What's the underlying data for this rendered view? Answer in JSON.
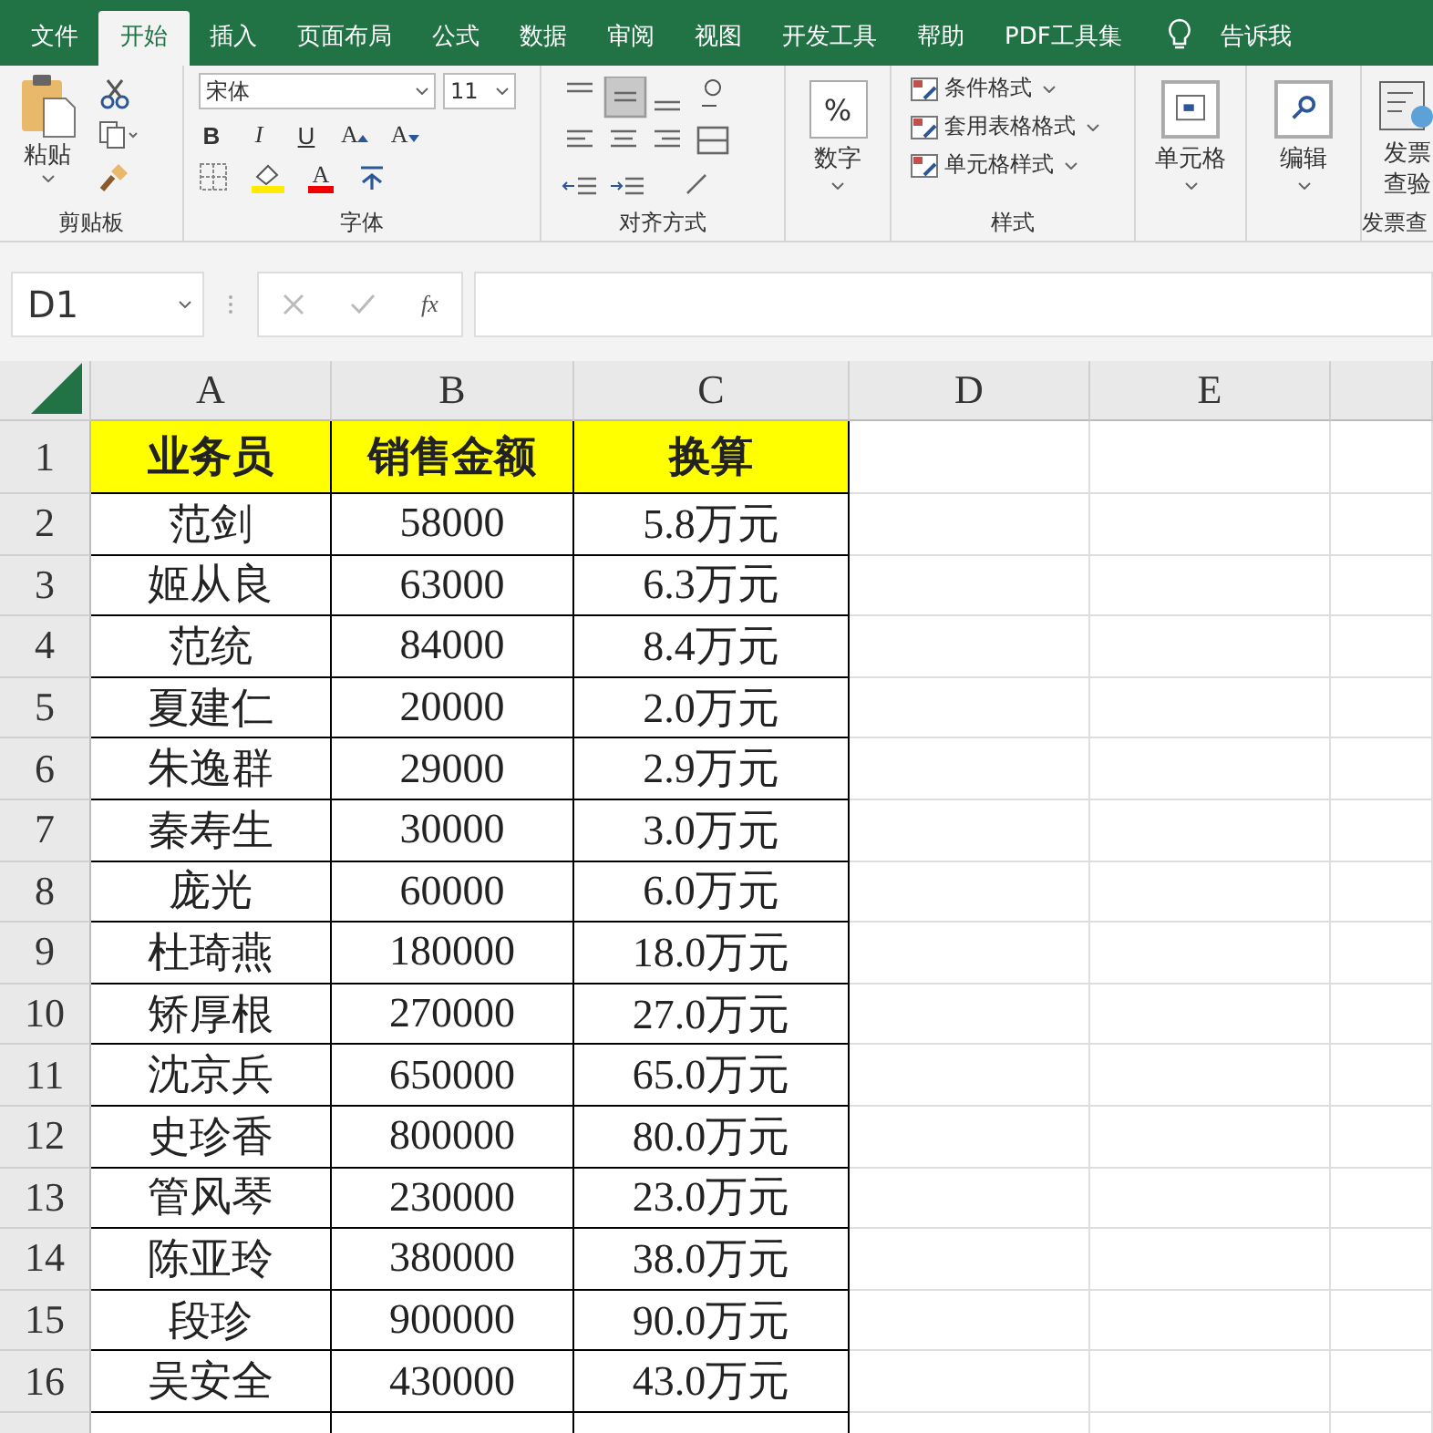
{
  "tabs": [
    {
      "label": "文件",
      "selected": false
    },
    {
      "label": "开始",
      "selected": true
    },
    {
      "label": "插入",
      "selected": false
    },
    {
      "label": "页面布局",
      "selected": false
    },
    {
      "label": "公式",
      "selected": false
    },
    {
      "label": "数据",
      "selected": false
    },
    {
      "label": "审阅",
      "selected": false
    },
    {
      "label": "视图",
      "selected": false
    },
    {
      "label": "开发工具",
      "selected": false
    },
    {
      "label": "帮助",
      "selected": false
    },
    {
      "label": "PDF工具集",
      "selected": false
    }
  ],
  "tell_me": "告诉我",
  "ribbon": {
    "clipboard": {
      "paste": "粘贴",
      "label": "剪贴板"
    },
    "font": {
      "font_name": "宋体",
      "font_size": "11",
      "bold": "B",
      "italic": "I",
      "underline": "U",
      "grow": "A",
      "shrink": "A",
      "font_color": "A",
      "label": "字体"
    },
    "alignment": {
      "label": "对齐方式"
    },
    "number": {
      "symbol": "%",
      "button": "数字"
    },
    "styles": {
      "items": [
        "条件格式",
        "套用表格格式",
        "单元格样式"
      ],
      "label": "样式"
    },
    "cells": {
      "button": "单元格"
    },
    "editing": {
      "button": "编辑"
    },
    "invoice": {
      "button": "发票查验",
      "label": "发票查"
    }
  },
  "formula_bar": {
    "name_box": "D1",
    "fx": "fx"
  },
  "columns": [
    "A",
    "B",
    "C",
    "D",
    "E"
  ],
  "rows": [
    {
      "number": "1",
      "cells": [
        "业务员",
        "销售金额",
        "换算"
      ],
      "header": true
    },
    {
      "number": "2",
      "cells": [
        "范剑",
        "58000",
        "5.8万元"
      ],
      "header": false
    },
    {
      "number": "3",
      "cells": [
        "姬从良",
        "63000",
        "6.3万元"
      ],
      "header": false
    },
    {
      "number": "4",
      "cells": [
        "范统",
        "84000",
        "8.4万元"
      ],
      "header": false
    },
    {
      "number": "5",
      "cells": [
        "夏建仁",
        "20000",
        "2.0万元"
      ],
      "header": false
    },
    {
      "number": "6",
      "cells": [
        "朱逸群",
        "29000",
        "2.9万元"
      ],
      "header": false
    },
    {
      "number": "7",
      "cells": [
        "秦寿生",
        "30000",
        "3.0万元"
      ],
      "header": false
    },
    {
      "number": "8",
      "cells": [
        "庞光",
        "60000",
        "6.0万元"
      ],
      "header": false
    },
    {
      "number": "9",
      "cells": [
        "杜琦燕",
        "180000",
        "18.0万元"
      ],
      "header": false
    },
    {
      "number": "10",
      "cells": [
        "矫厚根",
        "270000",
        "27.0万元"
      ],
      "header": false
    },
    {
      "number": "11",
      "cells": [
        "沈京兵",
        "650000",
        "65.0万元"
      ],
      "header": false
    },
    {
      "number": "12",
      "cells": [
        "史珍香",
        "800000",
        "80.0万元"
      ],
      "header": false
    },
    {
      "number": "13",
      "cells": [
        "管风琴",
        "230000",
        "23.0万元"
      ],
      "header": false
    },
    {
      "number": "14",
      "cells": [
        "陈亚玲",
        "380000",
        "38.0万元"
      ],
      "header": false
    },
    {
      "number": "15",
      "cells": [
        "段珍",
        "900000",
        "90.0万元"
      ],
      "header": false
    },
    {
      "number": "16",
      "cells": [
        "吴安全",
        "430000",
        "43.0万元"
      ],
      "header": false
    }
  ]
}
